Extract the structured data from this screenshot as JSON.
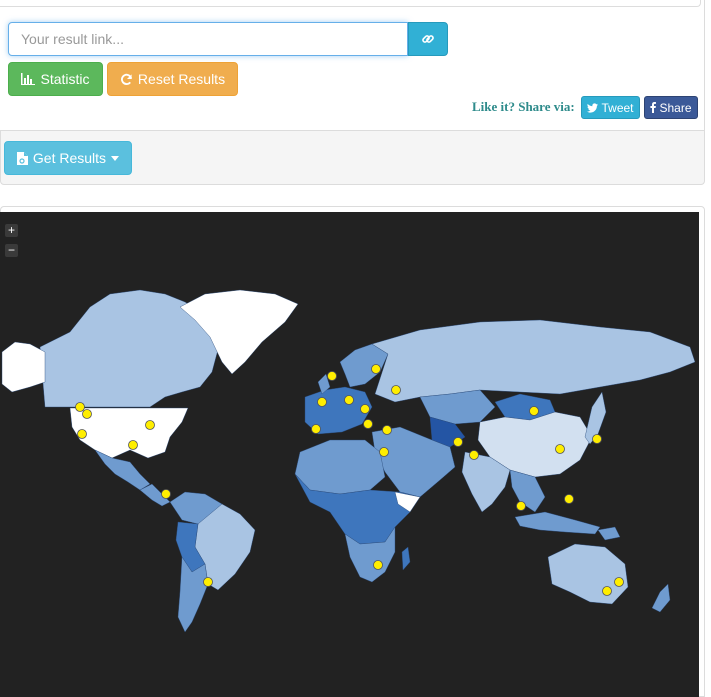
{
  "link_input": {
    "placeholder": "Your result link..."
  },
  "buttons": {
    "statistic": "Statistic",
    "reset": "Reset Results",
    "tweet": "Tweet",
    "share": "Share",
    "get_results": "Get Results"
  },
  "share_label": "Like it? Share via:",
  "map": {
    "zoom_in": "+",
    "zoom_out": "−",
    "colors": {
      "background": "#222222",
      "light": "#a9c4e3",
      "medium": "#6f9bcf",
      "dark": "#3e76bd",
      "darkest": "#2455a4",
      "marker": "#ffee00"
    }
  },
  "icons": [
    "link-icon",
    "bar-chart-icon",
    "refresh-icon",
    "twitter-icon",
    "facebook-icon",
    "file-icon",
    "caret-down-icon"
  ]
}
